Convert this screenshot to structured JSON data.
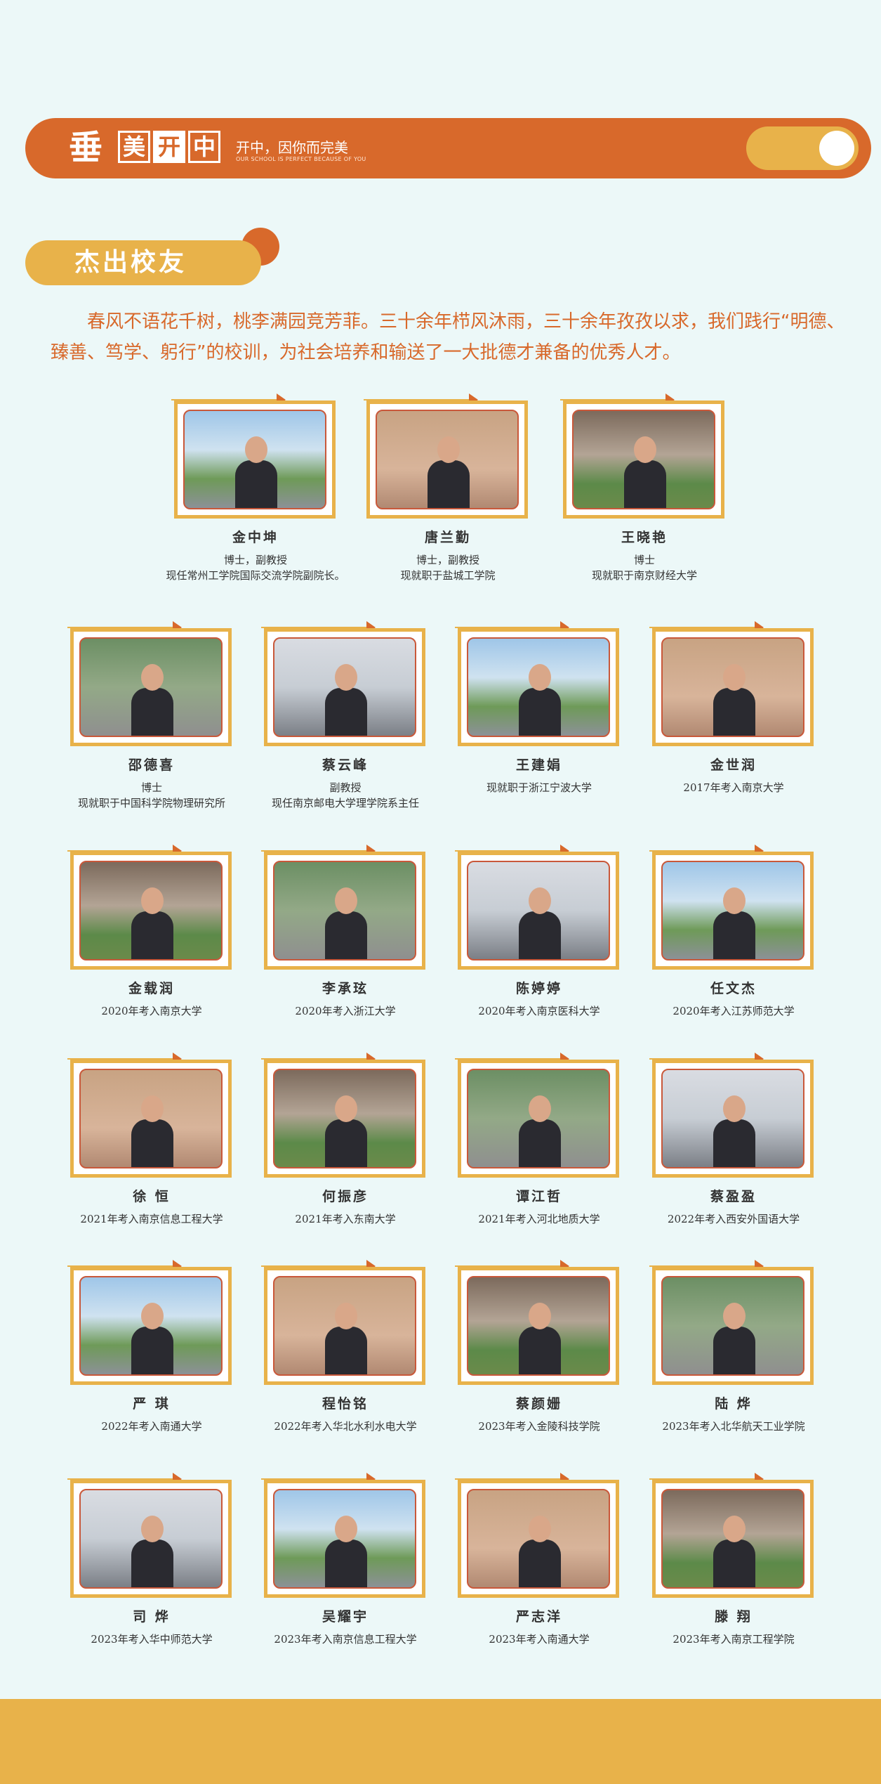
{
  "header": {
    "slogan": "开中，因你而完美",
    "slogan_en": "OUR SCHOOL IS PERFECT BECAUSE OF YOU",
    "logo_chars": [
      "美",
      "开",
      "中"
    ],
    "logo_mark": "垂"
  },
  "section": {
    "title": "杰出校友",
    "intro": "春风不语花千树，桃李满园竞芳菲。三十余年栉风沐雨，三十余年孜孜以求，我们践行“明德、臻善、笃学、躬行”的校训，为社会培养和输送了一大批德才兼备的优秀人才。"
  },
  "alumni": [
    {
      "name": "金中坤",
      "lines": [
        "博士，副教授",
        "现任常州工学院国际交流学院副院长。"
      ]
    },
    {
      "name": "唐兰勤",
      "lines": [
        "博士，副教授",
        "现就职于盐城工学院"
      ]
    },
    {
      "name": "王晓艳",
      "lines": [
        "博士",
        "现就职于南京财经大学"
      ]
    },
    {
      "name": "邵德喜",
      "lines": [
        "博士",
        "现就职于中国科学院物理研究所"
      ]
    },
    {
      "name": "蔡云峰",
      "lines": [
        "副教授",
        "现任南京邮电大学理学院系主任"
      ]
    },
    {
      "name": "王建娟",
      "lines": [
        "现就职于浙江宁波大学"
      ]
    },
    {
      "name": "金世润",
      "lines": [
        "2017年考入南京大学"
      ]
    },
    {
      "name": "金载润",
      "lines": [
        "2020年考入南京大学"
      ]
    },
    {
      "name": "李承玹",
      "lines": [
        "2020年考入浙江大学"
      ]
    },
    {
      "name": "陈婷婷",
      "lines": [
        "2020年考入南京医科大学"
      ]
    },
    {
      "name": "任文杰",
      "lines": [
        "2020年考入江苏师范大学"
      ]
    },
    {
      "name": "徐 恒",
      "lines": [
        "2021年考入南京信息工程大学"
      ]
    },
    {
      "name": "何振彦",
      "lines": [
        "2021年考入东南大学"
      ]
    },
    {
      "name": "谭江哲",
      "lines": [
        "2021年考入河北地质大学"
      ]
    },
    {
      "name": "蔡盈盈",
      "lines": [
        "2022年考入西安外国语大学"
      ]
    },
    {
      "name": "严 琪",
      "lines": [
        "2022年考入南通大学"
      ]
    },
    {
      "name": "程怡铭",
      "lines": [
        "2022年考入华北水利水电大学"
      ]
    },
    {
      "name": "蔡颜姗",
      "lines": [
        "2023年考入金陵科技学院"
      ]
    },
    {
      "name": "陆 烨",
      "lines": [
        "2023年考入北华航天工业学院"
      ]
    },
    {
      "name": "司 烨",
      "lines": [
        "2023年考入华中师范大学"
      ]
    },
    {
      "name": "吴耀宇",
      "lines": [
        "2023年考入南京信息工程大学"
      ]
    },
    {
      "name": "严志洋",
      "lines": [
        "2023年考入南通大学"
      ]
    },
    {
      "name": "滕 翔",
      "lines": [
        "2023年考入南京工程学院"
      ]
    }
  ],
  "colors": {
    "background": "#ecf8f8",
    "accent_orange": "#d8692b",
    "accent_yellow": "#e8b24a"
  }
}
